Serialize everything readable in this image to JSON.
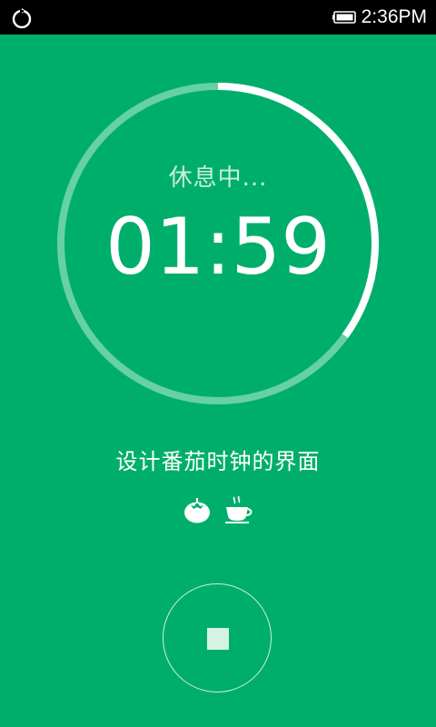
{
  "status_bar": {
    "time": "2:36PM",
    "left_icon": "refresh-icon",
    "battery_icon": "battery-icon"
  },
  "timer": {
    "state_label": "休息中...",
    "time": "01:59",
    "progress_fraction": 0.35
  },
  "task": {
    "title": "设计番茄时钟的界面"
  },
  "icons": {
    "pomodoro": "tomato-icon",
    "break": "coffee-cup-icon",
    "stop": "stop-icon"
  },
  "colors": {
    "background": "#00ae6b",
    "ring_track": "#66d1a4",
    "ring_progress": "#ffffff",
    "stop_square": "#d4f3e4"
  }
}
